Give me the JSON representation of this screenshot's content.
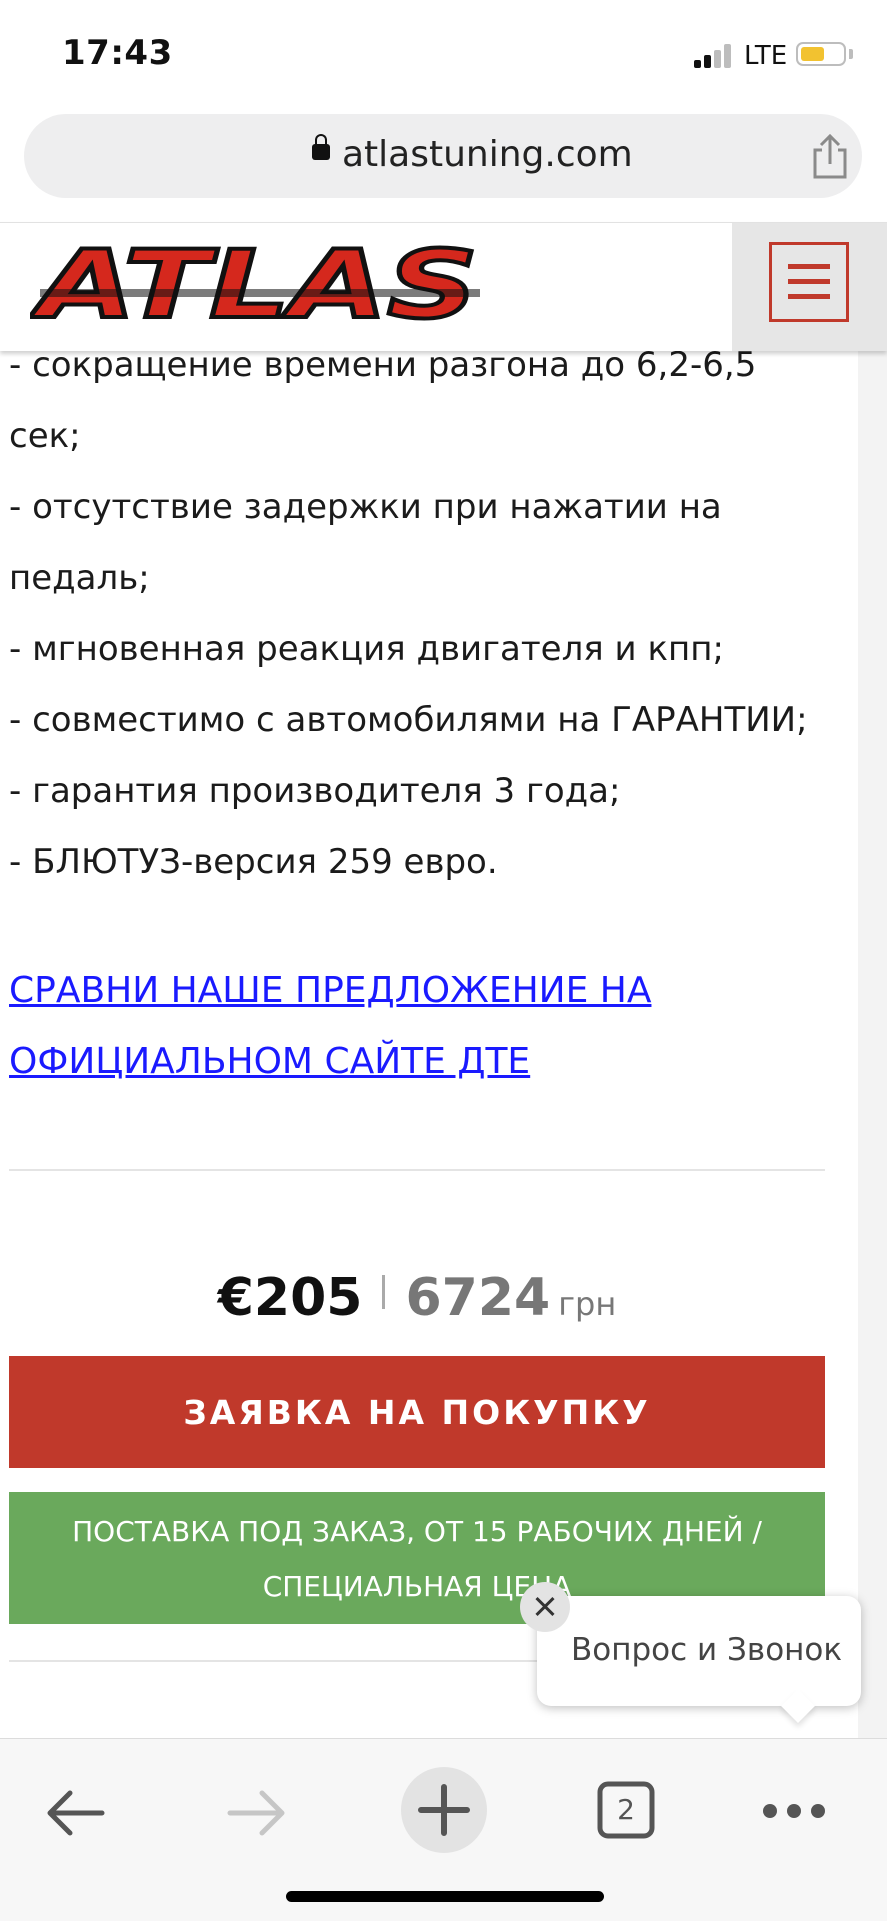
{
  "status_bar": {
    "time": "17:43",
    "network": "LTE"
  },
  "browser": {
    "url": "atlastuning.com"
  },
  "site": {
    "logo_text": "ATLAS"
  },
  "content": {
    "lines": [
      "- сокращение времени разгона до 6,2-6,5",
      "сек;",
      "- отсутствие задержки при нажатии на",
      "педаль;",
      "- мгновенная реакция двигателя и кпп;",
      "- совместимо с автомобилями на ГАРАНТИИ;",
      "- гарантия производителя 3 года;",
      "- БЛЮТУЗ-версия 259 евро."
    ],
    "compare_link_line1": "СРАВНИ НАШЕ ПРЕДЛОЖЕНИЕ НА",
    "compare_link_line2": "ОФИЦИАЛЬНОМ САЙТЕ ДТЕ"
  },
  "price": {
    "eur": "€205",
    "uah": "6724",
    "uah_currency": "грн"
  },
  "buy_button": "ЗАЯВКА НА ПОКУПКУ",
  "delivery": {
    "line1": "ПОСТАВКА ПОД ЗАКАЗ, ОТ 15 РАБОЧИХ ДНЕЙ /",
    "line2": "СПЕЦИАЛЬНАЯ ЦЕНА"
  },
  "chat_widget": {
    "text": "Вопрос и Звонок"
  },
  "toolbar": {
    "tab_count": "2"
  },
  "colors": {
    "brand_red": "#c0392b",
    "delivery_green": "#6aa95c",
    "link_blue": "#1a1aff",
    "battery_yellow": "#f2c230"
  },
  "icons": {
    "back": "arrow-left-icon",
    "forward": "arrow-right-icon",
    "new_tab": "plus-icon",
    "tabs": "tabs-icon",
    "more": "more-dots-icon",
    "share": "share-icon",
    "lock": "lock-icon",
    "menu": "hamburger-icon",
    "close": "close-icon"
  }
}
